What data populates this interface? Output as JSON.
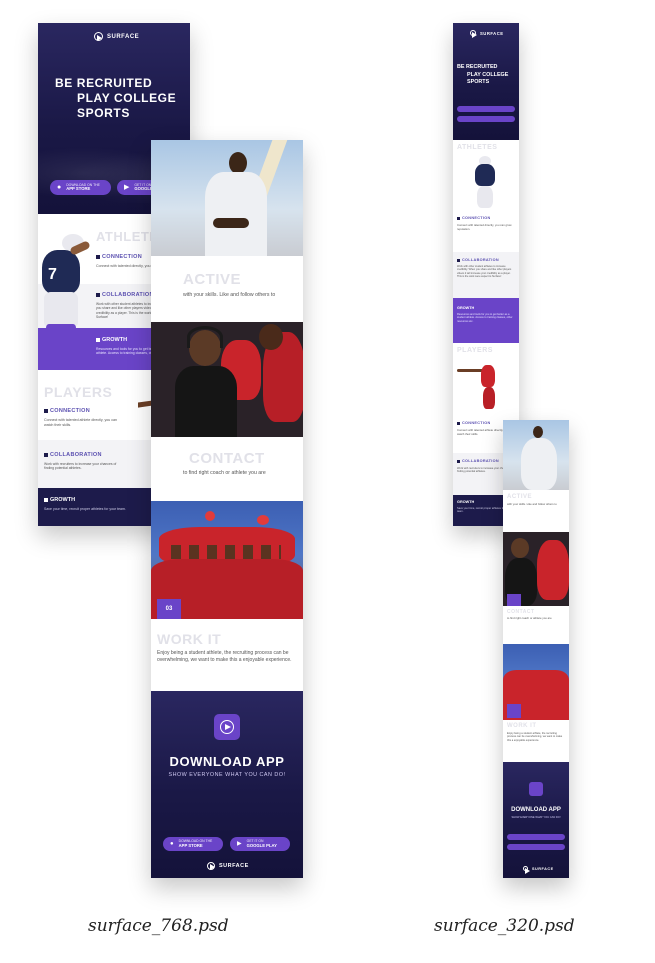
{
  "brand": "SURFACE",
  "hero": {
    "title_line1": "BE RECRUITED",
    "title_line2": "PLAY COLLEGE",
    "title_line3": "SPORTS"
  },
  "store_buttons": {
    "apple_line1": "DOWNLOAD ON THE",
    "apple_line2": "APP STORE",
    "google_line1": "GET IT ON",
    "google_line2": "GOOGLE PLAY"
  },
  "athletes": {
    "title": "ATHLETES",
    "connection_title": "CONNECTION",
    "connection_text": "Connect with talented directly, you can grow reputation.",
    "collaboration_title": "COLLABORATION",
    "collaboration_text": "Work with other student athletes to increase credibility. When you share and like other players videos it will increase your credibility as a player. This is the work were aspect to Surface!",
    "growth_title": "GROWTH",
    "growth_text": "Resources and tools for you to get better as a student athlete. Access to training classes, other resources etc."
  },
  "players": {
    "title": "PLAYERS",
    "connection_title": "CONNECTION",
    "connection_text": "Connect with talented athlete directly, you can watch their skills.",
    "collaboration_title": "COLLABORATION",
    "collaboration_text": "Work with recruiters to increase your chances of finding potential athletes.",
    "growth_title": "GROWTH",
    "growth_text": "Save your time, recruit proper athletes for your team."
  },
  "panel_768_right": {
    "active_title": "ACTIVE",
    "active_text": "with your skills. Like and follow others to",
    "contact_title": "CONTACT",
    "contact_text": "to find right coach or athlete you are",
    "badge": "03",
    "work_title": "WORK IT",
    "work_text": "Enjoy being a student athlete, the recruiting process can be overwhelming, we want to make this a enjoyable experience."
  },
  "download": {
    "title": "DOWNLOAD APP",
    "subtitle": "SHOW EVERYONE WHAT YOU CAN DO!"
  },
  "captions": {
    "left": "surface_768.psd",
    "right": "surface_320.psd"
  },
  "colors": {
    "navy": "#1d1b4b",
    "purple": "#6a44c8",
    "jersey_red": "#c9242b"
  }
}
